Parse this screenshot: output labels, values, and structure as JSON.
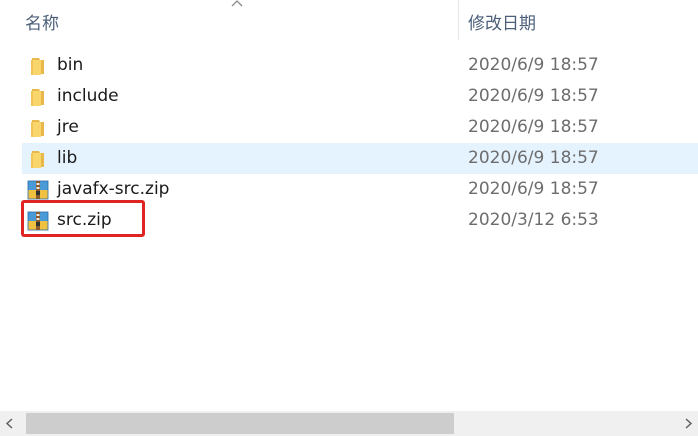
{
  "columns": {
    "name": "名称",
    "date_modified": "修改日期"
  },
  "files": [
    {
      "name": "bin",
      "date": "2020/6/9 18:57",
      "icon": "folder-icon"
    },
    {
      "name": "include",
      "date": "2020/6/9 18:57",
      "icon": "folder-icon"
    },
    {
      "name": "jre",
      "date": "2020/6/9 18:57",
      "icon": "folder-icon"
    },
    {
      "name": "lib",
      "date": "2020/6/9 18:57",
      "icon": "folder-icon",
      "hovered": true
    },
    {
      "name": "javafx-src.zip",
      "date": "2020/6/9 18:57",
      "icon": "zip-archive-icon"
    },
    {
      "name": "src.zip",
      "date": "2020/3/12 6:53",
      "icon": "zip-archive-icon",
      "annotated": true
    }
  ],
  "colors": {
    "folder": "#f8d66c",
    "hover_row": "#e5f3ff",
    "annotation_box": "#e02424",
    "header_text": "#4c607a",
    "date_text": "#6d6d6d"
  },
  "icons": {
    "sort": "chevron-up-icon",
    "scroll_left": "arrow-left-icon",
    "scroll_right": "arrow-right-icon"
  }
}
